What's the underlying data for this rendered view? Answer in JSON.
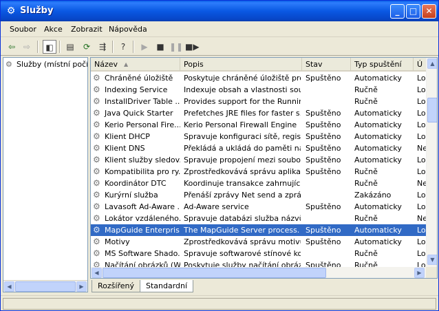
{
  "window": {
    "title": "Služby"
  },
  "menu": [
    "Soubor",
    "Akce",
    "Zobrazit",
    "Nápověda"
  ],
  "tree": {
    "root_label": "Služby (místní počíta"
  },
  "columns": [
    "Název",
    "Popis",
    "Stav",
    "Typ spuštění",
    "Ú"
  ],
  "rows": [
    {
      "name": "Chráněné úložiště",
      "desc": "Poskytuje chráněné úložiště pro...",
      "status": "Spuštěno",
      "startup": "Automaticky",
      "logon": "Lo"
    },
    {
      "name": "Indexing Service",
      "desc": "Indexuje obsah a vlastnosti sou...",
      "status": "",
      "startup": "Ručně",
      "logon": "Lo"
    },
    {
      "name": "InstallDriver Table ...",
      "desc": "Provides support for the Runnin...",
      "status": "",
      "startup": "Ručně",
      "logon": "Lo"
    },
    {
      "name": "Java Quick Starter",
      "desc": "Prefetches JRE files for faster s...",
      "status": "Spuštěno",
      "startup": "Automaticky",
      "logon": "Lo"
    },
    {
      "name": "Kerio Personal Fire...",
      "desc": "Kerio Personal Firewall Engine",
      "status": "Spuštěno",
      "startup": "Automaticky",
      "logon": "Lo"
    },
    {
      "name": "Klient DHCP",
      "desc": "Spravuje konfiguraci sítě, regist...",
      "status": "Spuštěno",
      "startup": "Automaticky",
      "logon": "Lo"
    },
    {
      "name": "Klient DNS",
      "desc": "Překládá a ukládá do paměti ná...",
      "status": "Spuštěno",
      "startup": "Automaticky",
      "logon": "Ne"
    },
    {
      "name": "Klient služby sledov...",
      "desc": "Spravuje propojení mezi soubor...",
      "status": "Spuštěno",
      "startup": "Automaticky",
      "logon": "Lo"
    },
    {
      "name": "Kompatibilita pro ry...",
      "desc": "Zprostředkovává správu aplikac...",
      "status": "Spuštěno",
      "startup": "Ručně",
      "logon": "Lo"
    },
    {
      "name": "Koordinátor DTC",
      "desc": "Koordinuje transakce zahrnující ...",
      "status": "",
      "startup": "Ručně",
      "logon": "Ne"
    },
    {
      "name": "Kurýrní služba",
      "desc": "Přenáší zprávy Net send a zprá...",
      "status": "",
      "startup": "Zakázáno",
      "logon": "Lo"
    },
    {
      "name": "Lavasoft Ad-Aware ...",
      "desc": "Ad-Aware service",
      "status": "Spuštěno",
      "startup": "Automaticky",
      "logon": "Lo"
    },
    {
      "name": "Lokátor vzdáleného...",
      "desc": "Spravuje databázi služba názvů...",
      "status": "",
      "startup": "Ručně",
      "logon": "Ne"
    },
    {
      "name": "MapGuide Enterpris...",
      "desc": "The MapGuide Server process.",
      "status": "Spuštěno",
      "startup": "Automaticky",
      "logon": "Lo",
      "selected": true
    },
    {
      "name": "Motivy",
      "desc": "Zprostředkovává správu motivů.",
      "status": "Spuštěno",
      "startup": "Automaticky",
      "logon": "Lo"
    },
    {
      "name": "MS Software Shado...",
      "desc": "Spravuje softwarové stínové ko...",
      "status": "",
      "startup": "Ručně",
      "logon": "Lo"
    },
    {
      "name": "Načítání obrázků (W...",
      "desc": "Poskytuje služby načítání obráz...",
      "status": "Spuštěno",
      "startup": "Ručně",
      "logon": "Lo"
    }
  ],
  "tabs": [
    "Rozšířený",
    "Standardní"
  ],
  "active_tab": "Standardní",
  "colors": {
    "title_bar": "#0a58e3",
    "selection": "#316ac5"
  },
  "icons": {
    "title": "services-icon",
    "back": "back-arrow-icon",
    "forward": "forward-arrow-icon",
    "show_tree": "console-tree-icon",
    "properties": "properties-icon",
    "refresh": "refresh-icon",
    "export": "export-list-icon",
    "help": "help-icon",
    "start": "play-icon",
    "stop": "stop-icon",
    "pause": "pause-icon",
    "restart": "restart-icon",
    "row": "gear-icon"
  }
}
